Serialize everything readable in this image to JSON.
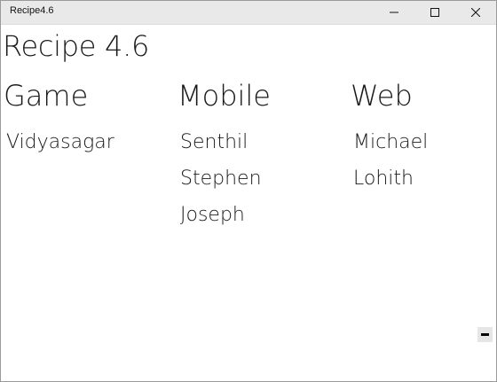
{
  "window": {
    "title": "Recipe4.6"
  },
  "page": {
    "title": "Recipe 4.6"
  },
  "groups": [
    {
      "header": "Game",
      "items": [
        "Vidyasagar"
      ]
    },
    {
      "header": "Mobile",
      "items": [
        "Senthil",
        "Stephen",
        "Joseph"
      ]
    },
    {
      "header": "Web",
      "items": [
        "Michael",
        "Lohith"
      ]
    }
  ],
  "icons": {
    "minimize": "minimize-icon",
    "maximize": "maximize-icon",
    "close": "close-icon",
    "zoom_out": "minus-icon"
  }
}
